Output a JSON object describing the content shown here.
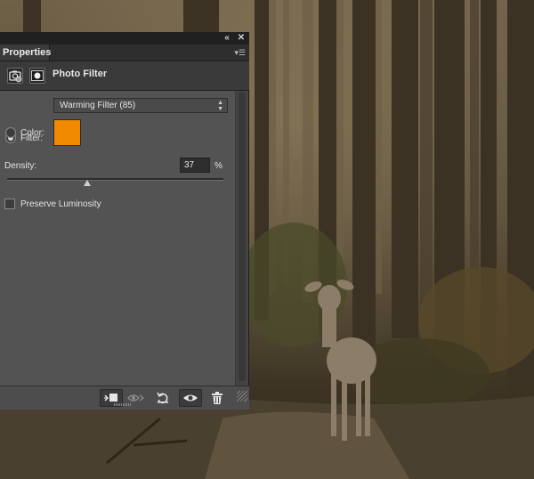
{
  "panel": {
    "tab_label": "Properties",
    "header_title": "Photo Filter"
  },
  "filter": {
    "label": "Filter:",
    "selected": "Warming Filter (85)",
    "radio_selected": true
  },
  "color": {
    "label": "Color:",
    "swatch": "#f28a00",
    "radio_selected": false
  },
  "density": {
    "label": "Density:",
    "value": "37",
    "unit": "%",
    "fraction": 0.37
  },
  "preserve": {
    "label": "Preserve Luminosity",
    "checked": false
  },
  "icons": {
    "collapse": "double-chevron-left-icon",
    "close": "close-icon",
    "panel_menu": "panel-menu-icon",
    "adjustment": "camera-filter-icon",
    "mask": "layer-mask-icon",
    "clip": "clip-to-layer-icon",
    "view_previous": "view-previous-state-icon",
    "reset": "reset-icon",
    "visibility": "eye-icon",
    "delete": "trash-icon"
  }
}
